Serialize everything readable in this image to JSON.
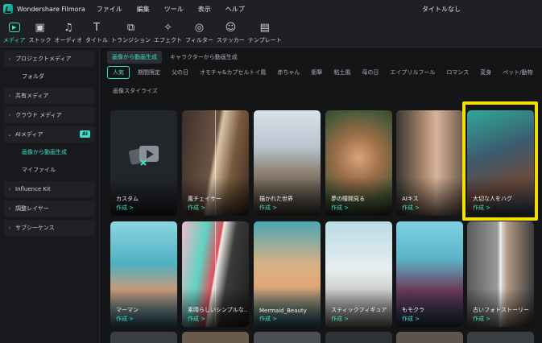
{
  "titlebar": {
    "app_name": "Wondershare Filmora",
    "menus": [
      "ファイル",
      "編集",
      "ツール",
      "表示",
      "ヘルプ"
    ],
    "doc_title": "タイトルなし"
  },
  "toolbar": {
    "tools": [
      {
        "label": "メディア",
        "icon": "media-icon",
        "active": true
      },
      {
        "label": "ストック",
        "icon": "stock-icon"
      },
      {
        "label": "オーディオ",
        "icon": "audio-icon"
      },
      {
        "label": "タイトル",
        "icon": "title-icon"
      },
      {
        "label": "トランジション",
        "icon": "transition-icon"
      },
      {
        "label": "エフェクト",
        "icon": "effects-icon"
      },
      {
        "label": "フィルター",
        "icon": "filter-icon"
      },
      {
        "label": "ステッカー",
        "icon": "sticker-icon"
      },
      {
        "label": "テンプレート",
        "icon": "template-icon"
      }
    ]
  },
  "sidebar": {
    "project_media": "プロジェクトメディア",
    "folder": "フォルダ",
    "shared_media": "共有メディア",
    "cloud_media": "クラウド メディア",
    "ai_media": "AIメディア",
    "ai_badge": "AI",
    "img_to_video": "画像から動画生成",
    "my_files": "マイファイル",
    "influence_kit": "Influence Kit",
    "adjust_layer": "調整レイヤー",
    "subsequence": "サブシーケンス"
  },
  "content": {
    "mode_tabs": [
      "画像から動画生成",
      "キャラクターから動画生成"
    ],
    "categories": [
      "人気",
      "期間限定",
      "父の日",
      "オモチャ&カプセルトイ風",
      "赤ちゃん",
      "衝撃",
      "粘土風",
      "母の日",
      "エイプリルフール",
      "ロマンス",
      "変身",
      "ペット/動物",
      "元気"
    ],
    "category_row2": "画像スタイライズ",
    "cards_row1": [
      {
        "title": "カスタム",
        "action": "作成 >"
      },
      {
        "title": "風チェイサー",
        "action": "作成 >"
      },
      {
        "title": "描かれた世界",
        "action": "作成 >"
      },
      {
        "title": "夢の瞳開見る",
        "action": "作成 >"
      },
      {
        "title": "AIキス",
        "action": "作成 >"
      },
      {
        "title": "大切な人をハグ",
        "action": "作成 >"
      }
    ],
    "cards_row2": [
      {
        "title": "マーマン",
        "action": "作成 >"
      },
      {
        "title": "素晴らしいシンプルな...",
        "action": "作成 >"
      },
      {
        "title": "Mermaid_Beauty",
        "action": "作成 >"
      },
      {
        "title": "スティックフィギュア",
        "action": "作成 >"
      },
      {
        "title": "もモクラ",
        "action": "作成 >"
      },
      {
        "title": "古いフォトストーリー",
        "action": "作成 >"
      }
    ]
  },
  "colors": {
    "accent": "#3fe0c5",
    "highlight": "#f2e000",
    "bg": "#141517"
  }
}
